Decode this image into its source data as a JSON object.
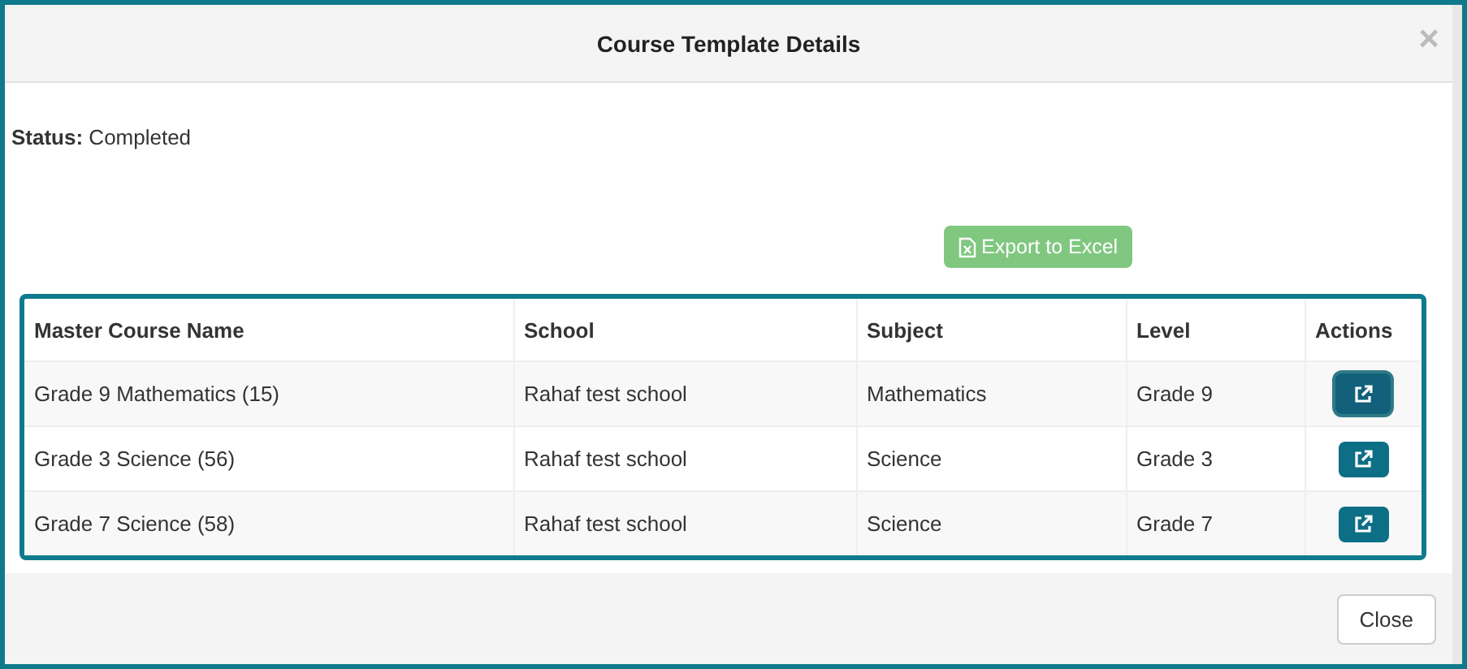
{
  "dialog": {
    "title": "Course Template Details",
    "close_icon": "×"
  },
  "status": {
    "label": "Status:",
    "value": "Completed"
  },
  "export_button": {
    "label": "Export to Excel",
    "disabled": true
  },
  "table": {
    "columns": [
      "Master Course Name",
      "School",
      "Subject",
      "Level",
      "Actions"
    ],
    "rows": [
      {
        "cells": [
          "Grade 9 Mathematics (15)",
          "Rahaf test school",
          "Mathematics",
          "Grade 9"
        ],
        "focused": true
      },
      {
        "cells": [
          "Grade 3 Science (56)",
          "Rahaf test school",
          "Science",
          "Grade 3"
        ],
        "focused": false
      },
      {
        "cells": [
          "Grade 7 Science (58)",
          "Rahaf test school",
          "Science",
          "Grade 7"
        ],
        "focused": false
      }
    ]
  },
  "footer": {
    "close_button": "Close"
  }
}
